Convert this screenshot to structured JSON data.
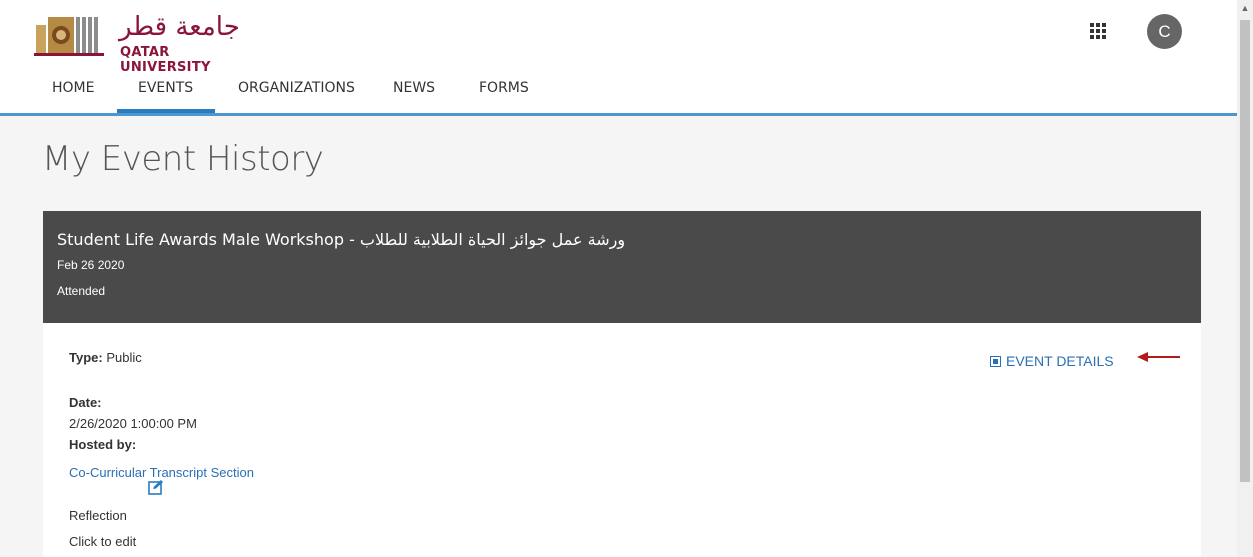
{
  "header": {
    "logo_arabic": "جامعة قطر",
    "logo_latin": "QATAR UNIVERSITY",
    "avatar_initial": "C"
  },
  "nav": {
    "items": [
      {
        "label": "HOME"
      },
      {
        "label": "EVENTS",
        "active": true
      },
      {
        "label": "ORGANIZATIONS"
      },
      {
        "label": "NEWS"
      },
      {
        "label": "FORMS"
      }
    ]
  },
  "page": {
    "title": "My Event History"
  },
  "event": {
    "title": "Student Life Awards Male Workshop - ورشة عمل جوائز الحياة الطلابية للطلاب",
    "date": "Feb 26 2020",
    "status": "Attended",
    "type_label": "Type:",
    "type_value": "Public",
    "details_link": "EVENT DETAILS",
    "date_label": "Date:",
    "date_value": "2/26/2020 1:00:00 PM",
    "hosted_label": "Hosted by:",
    "hosted_value": "Co-Curricular Transcript Section",
    "reflection_label": "Reflection",
    "reflection_hint": "Click to edit"
  },
  "colors": {
    "brand": "#8a1538",
    "accent": "#2a7bbf",
    "header_bg": "#4a4a4a",
    "arrow": "#b01c1c"
  }
}
